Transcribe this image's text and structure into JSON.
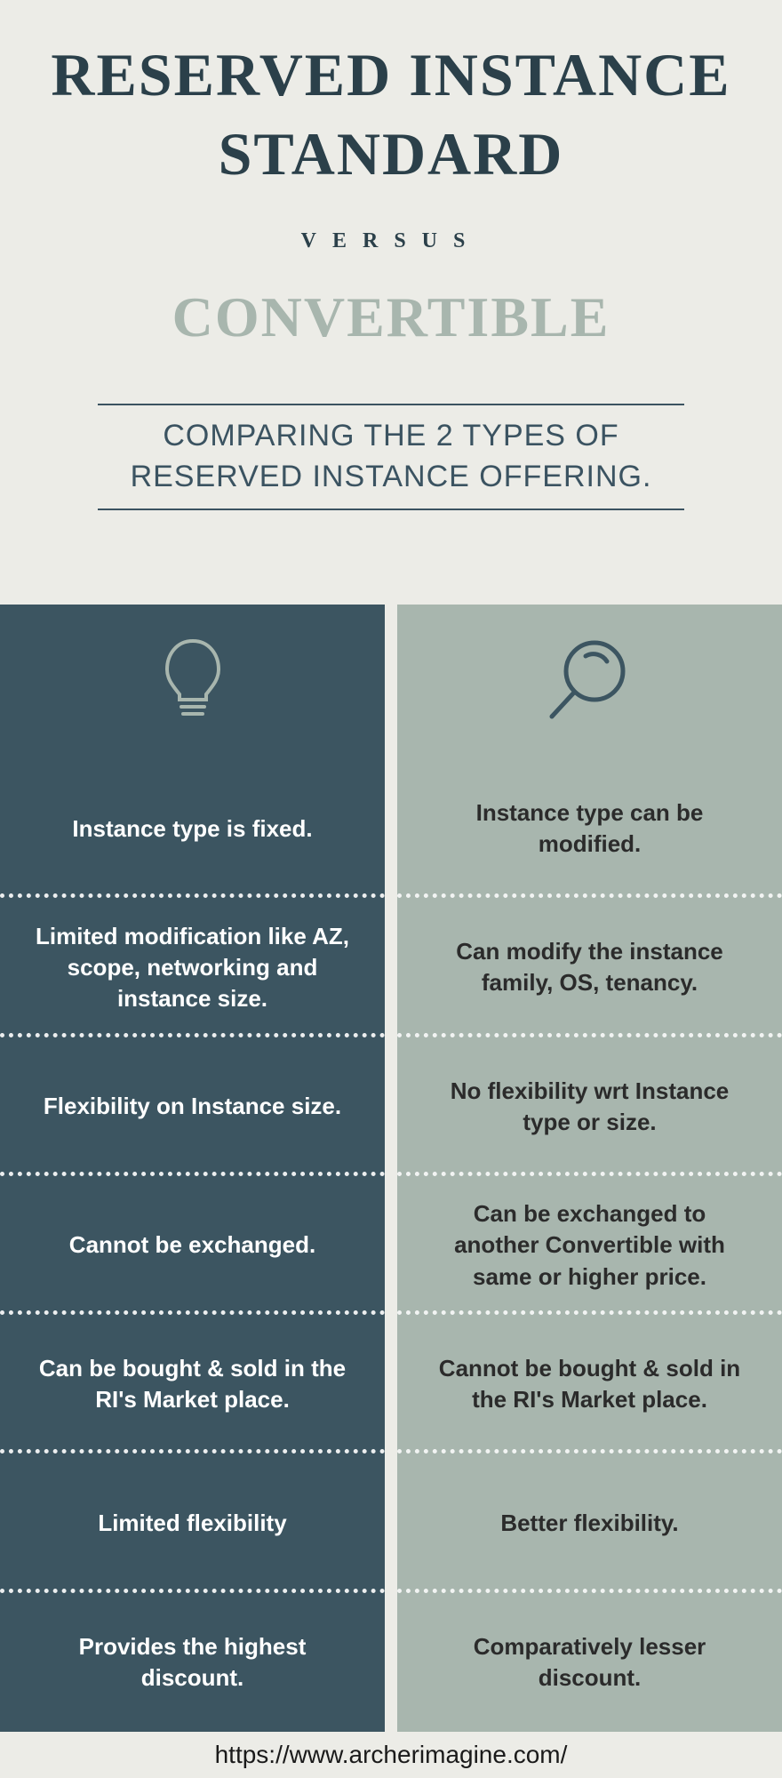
{
  "header": {
    "line1": "RESERVED INSTANCE",
    "line2": "STANDARD",
    "versus": "VERSUS",
    "line3": "CONVERTIBLE",
    "subtitle": "COMPARING THE 2 TYPES OF RESERVED INSTANCE OFFERING."
  },
  "left": {
    "rows": [
      "Instance type is fixed.",
      "Limited modification like AZ, scope, networking and instance size.",
      "Flexibility on Instance size.",
      "Cannot be exchanged.",
      "Can be bought & sold in the RI's Market place.",
      "Limited flexibility",
      "Provides the highest discount."
    ]
  },
  "right": {
    "rows": [
      "Instance type can be modified.",
      "Can modify the instance family, OS, tenancy.",
      "No flexibility wrt Instance type or size.",
      "Can be exchanged to another Convertible with same or higher price.",
      "Cannot be bought & sold in the RI's Market place.",
      "Better flexibility.",
      "Comparatively lesser discount."
    ]
  },
  "footer": {
    "url": "https://www.archerimagine.com/"
  }
}
